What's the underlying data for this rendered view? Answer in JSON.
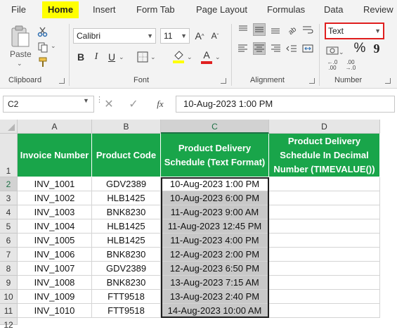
{
  "ribbon_tabs": [
    "File",
    "Home",
    "Insert",
    "Form Tab",
    "Page Layout",
    "Formulas",
    "Data",
    "Review"
  ],
  "clipboard": {
    "paste_label": "Paste",
    "group_label": "Clipboard"
  },
  "font": {
    "name": "Calibri",
    "size": "11",
    "group_label": "Font"
  },
  "alignment": {
    "group_label": "Alignment"
  },
  "number": {
    "format": "Text",
    "group_label": "Number",
    "percent": "%",
    "comma": "9"
  },
  "formula_bar": {
    "name_box": "C2",
    "fx": "fx",
    "content": "10-Aug-2023 1:00 PM"
  },
  "columns": [
    "A",
    "B",
    "C",
    "D"
  ],
  "headers": [
    "Invoice Number",
    "Product Code",
    "Product Delivery Schedule (Text Format)",
    "Product Delivery Schedule In Decimal Number (TIMEVALUE())"
  ],
  "rows": [
    {
      "n": "1"
    },
    {
      "n": "2",
      "a": "INV_1001",
      "b": "GDV2389",
      "c": "10-Aug-2023 1:00 PM"
    },
    {
      "n": "3",
      "a": "INV_1002",
      "b": "HLB1425",
      "c": "10-Aug-2023 6:00 PM"
    },
    {
      "n": "4",
      "a": "INV_1003",
      "b": "BNK8230",
      "c": "11-Aug-2023 9:00 AM"
    },
    {
      "n": "5",
      "a": "INV_1004",
      "b": "HLB1425",
      "c": "11-Aug-2023 12:45 PM"
    },
    {
      "n": "6",
      "a": "INV_1005",
      "b": "HLB1425",
      "c": "11-Aug-2023 4:00 PM"
    },
    {
      "n": "7",
      "a": "INV_1006",
      "b": "BNK8230",
      "c": "12-Aug-2023 2:00 PM"
    },
    {
      "n": "8",
      "a": "INV_1007",
      "b": "GDV2389",
      "c": "12-Aug-2023 6:50 PM"
    },
    {
      "n": "9",
      "a": "INV_1008",
      "b": "BNK8230",
      "c": "13-Aug-2023 7:15 AM"
    },
    {
      "n": "10",
      "a": "INV_1009",
      "b": "FTT9518",
      "c": "13-Aug-2023 2:40 PM"
    },
    {
      "n": "11",
      "a": "INV_1010",
      "b": "FTT9518",
      "c": "14-Aug-2023 10:00 AM"
    },
    {
      "n": "12"
    }
  ],
  "colors": {
    "header_green": "#19a54a",
    "selection_gray": "#c8c8c8",
    "home_highlight": "#ffff00",
    "format_box_red": "#e01f1f"
  }
}
